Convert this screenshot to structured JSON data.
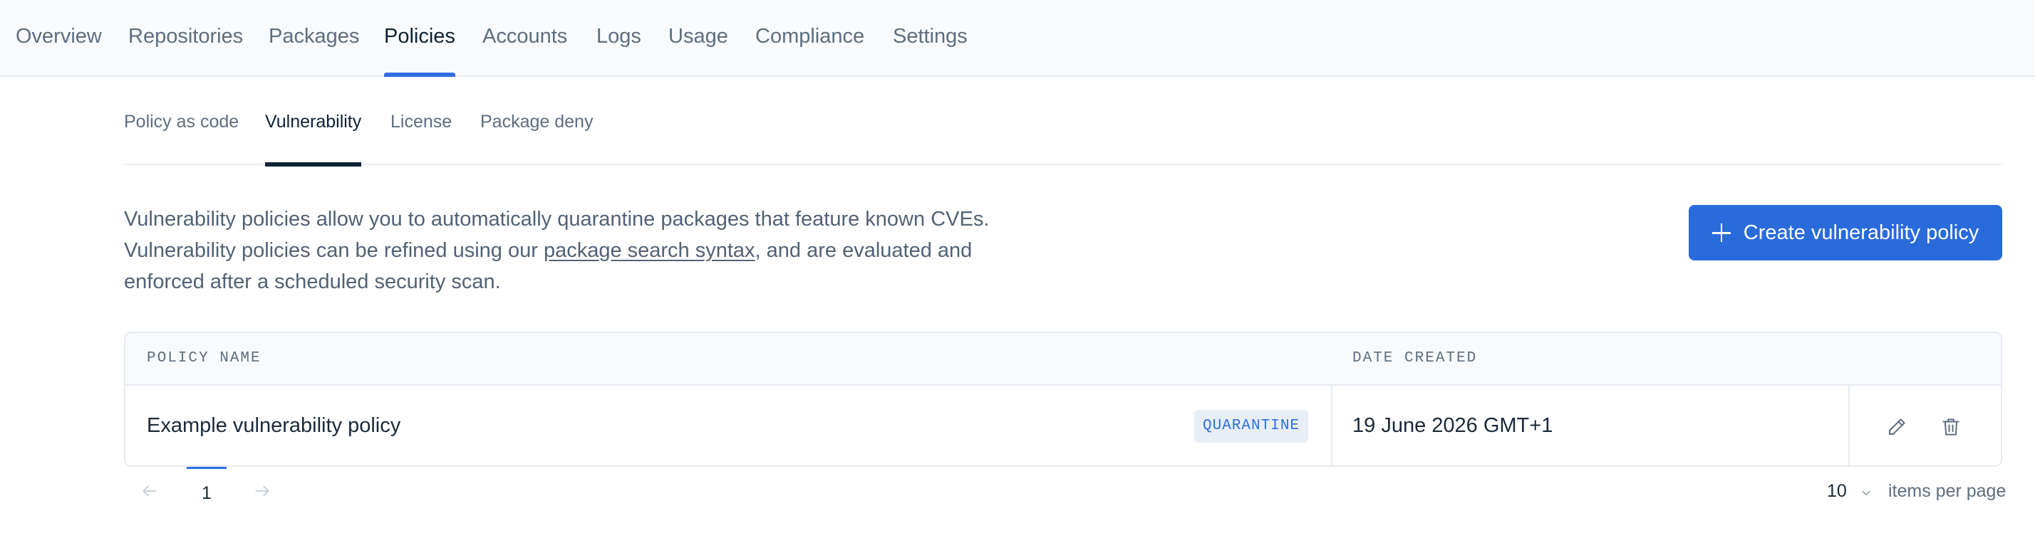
{
  "topnav": {
    "tabs": [
      {
        "label": "Overview"
      },
      {
        "label": "Repositories"
      },
      {
        "label": "Packages"
      },
      {
        "label": "Policies",
        "active": true
      },
      {
        "label": "Accounts"
      },
      {
        "label": "Logs"
      },
      {
        "label": "Usage"
      },
      {
        "label": "Compliance"
      },
      {
        "label": "Settings"
      }
    ]
  },
  "subtabs": {
    "tabs": [
      {
        "label": "Policy as code"
      },
      {
        "label": "Vulnerability",
        "active": true
      },
      {
        "label": "License"
      },
      {
        "label": "Package deny"
      }
    ]
  },
  "description": {
    "line1": "Vulnerability policies allow you to automatically quarantine packages that feature known CVEs.",
    "line2_before": "Vulnerability policies can be refined using our ",
    "link_text": "package search syntax",
    "line2_after": ", and are evaluated and",
    "line3": "enforced after a scheduled security scan."
  },
  "create_button": {
    "label": "Create vulnerability policy",
    "icon": "plus-icon"
  },
  "table": {
    "headers": {
      "policy_name": "POLICY NAME",
      "date_created": "DATE CREATED"
    },
    "rows": [
      {
        "policy_name": "Example vulnerability policy",
        "action_badge": "QUARANTINE",
        "date_created": "19 June 2026 GMT+1",
        "actions": [
          "pencil-icon",
          "trash-icon"
        ]
      }
    ]
  },
  "pagination": {
    "current_page": "1",
    "per_page_value": "10",
    "per_page_label": "items per page"
  },
  "colors": {
    "accent": "#2a6bdc",
    "nav_background": "#f8fafd",
    "badge_background": "#e7eef6",
    "text_muted": "#5e6e80",
    "text_dark": "#0f2236"
  }
}
